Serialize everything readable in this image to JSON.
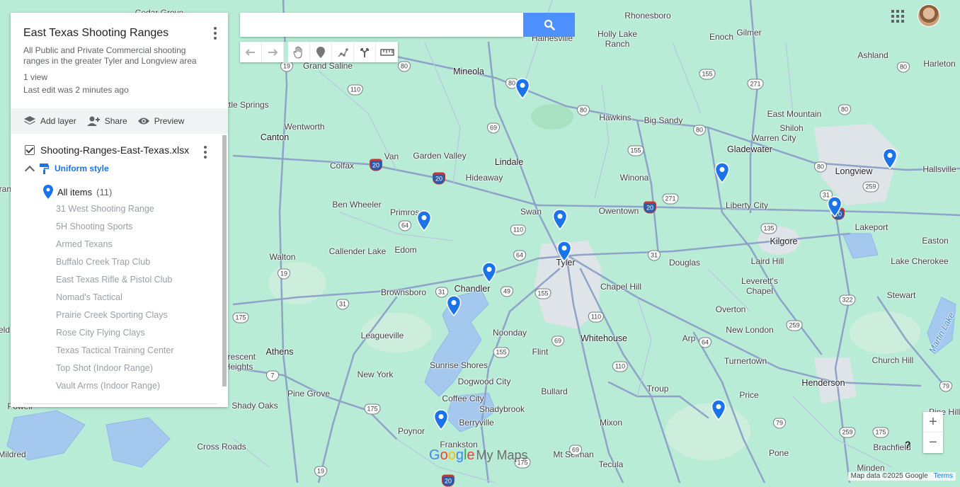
{
  "panel": {
    "title": "East Texas Shooting Ranges",
    "description": "All Public and Private Commercial shooting ranges in the greater Tyler and Longview area",
    "views": "1 view",
    "last_edit": "Last edit was 2 minutes ago",
    "toolbar": {
      "add_layer": "Add layer",
      "share": "Share",
      "preview": "Preview"
    },
    "layer": {
      "name": "Shooting-Ranges-East-Texas.xlsx",
      "checked": true,
      "style": "Uniform style",
      "all_items_label": "All items",
      "all_items_count": "(11)",
      "items": [
        "31 West Shooting Range",
        "5H Shooting Sports",
        "Armed Texans",
        "Buffalo Creek Trap Club",
        "East Texas Rifle & Pistol Club",
        "Nomad's Tactical",
        "Prairie Creek Sporting Clays",
        "Rose City Flying Clays",
        "Texas Tactical Training Center",
        "Top Shot (Indoor Range)",
        "Vault Arms (Indoor Range)"
      ]
    }
  },
  "search": {
    "value": "",
    "placeholder": ""
  },
  "tool_icons": [
    "undo-icon",
    "redo-icon",
    "hand-icon",
    "marker-icon",
    "draw-line-icon",
    "directions-icon",
    "ruler-icon"
  ],
  "map": {
    "places": [
      {
        "name": "Grand Saline"
      },
      {
        "name": "Rhonesboro"
      },
      {
        "name": "Gilmer"
      },
      {
        "name": "Enoch"
      },
      {
        "name": "Holly Lake Ranch"
      },
      {
        "name": "Hainesville"
      },
      {
        "name": "Ashland"
      },
      {
        "name": "Harleton"
      },
      {
        "name": "Mineola"
      },
      {
        "name": "Little Springs"
      },
      {
        "name": "Hawkins"
      },
      {
        "name": "Big Sandy"
      },
      {
        "name": "East Mountain"
      },
      {
        "name": "Shiloh"
      },
      {
        "name": "Warren City"
      },
      {
        "name": "Canton"
      },
      {
        "name": "Wentworth"
      },
      {
        "name": "Gladewater"
      },
      {
        "name": "Longview"
      },
      {
        "name": "Hallsville"
      },
      {
        "name": "Van"
      },
      {
        "name": "Garden Valley"
      },
      {
        "name": "Colfax"
      },
      {
        "name": "Lindale"
      },
      {
        "name": "Winona"
      },
      {
        "name": "Hideaway"
      },
      {
        "name": "Ben Wheeler"
      },
      {
        "name": "Primrose"
      },
      {
        "name": "Swan"
      },
      {
        "name": "Owentown"
      },
      {
        "name": "Liberty City"
      },
      {
        "name": "Lakeport"
      },
      {
        "name": "Easton"
      },
      {
        "name": "Callender Lake"
      },
      {
        "name": "Edom"
      },
      {
        "name": "Kilgore"
      },
      {
        "name": "Walton"
      },
      {
        "name": "Tyler"
      },
      {
        "name": "Douglas"
      },
      {
        "name": "Laird Hill"
      },
      {
        "name": "Lake Cherokee"
      },
      {
        "name": "Brownsboro"
      },
      {
        "name": "Chandler"
      },
      {
        "name": "Chapel Hill"
      },
      {
        "name": "Leverett's Chapel"
      },
      {
        "name": "Stewart"
      },
      {
        "name": "Overton"
      },
      {
        "name": "Leagueville"
      },
      {
        "name": "Noonday"
      },
      {
        "name": "Whitehouse"
      },
      {
        "name": "New London"
      },
      {
        "name": "Athens"
      },
      {
        "name": "Flint"
      },
      {
        "name": "Arp"
      },
      {
        "name": "Crescent Heights"
      },
      {
        "name": "Turnertown"
      },
      {
        "name": "Sunrise Shores"
      },
      {
        "name": "Church Hill"
      },
      {
        "name": "New York"
      },
      {
        "name": "Dogwood City"
      },
      {
        "name": "Bullard"
      },
      {
        "name": "Henderson"
      },
      {
        "name": "Pine Grove"
      },
      {
        "name": "Troup"
      },
      {
        "name": "Coffee City"
      },
      {
        "name": "Price"
      },
      {
        "name": "Shady Oaks"
      },
      {
        "name": "Shadybrook"
      },
      {
        "name": "Pine Hill"
      },
      {
        "name": "Berryville"
      },
      {
        "name": "Mixon"
      },
      {
        "name": "Poynor"
      },
      {
        "name": "Cross Roads"
      },
      {
        "name": "Mt Selman"
      },
      {
        "name": "Frankston"
      },
      {
        "name": "Pone"
      },
      {
        "name": "Brachfield"
      },
      {
        "name": "Mildred"
      },
      {
        "name": "Tecula"
      },
      {
        "name": "Minden"
      },
      {
        "name": "Cedar Grove"
      },
      {
        "name": "Powell"
      },
      {
        "name": "Grand"
      },
      {
        "name": "eld"
      }
    ],
    "water_labels": [
      "Martin Lake"
    ],
    "highway_shields": [
      {
        "num": "19"
      },
      {
        "num": "80"
      },
      {
        "num": "80"
      },
      {
        "num": "155"
      },
      {
        "num": "80"
      },
      {
        "num": "110"
      },
      {
        "num": "271"
      },
      {
        "num": "80"
      },
      {
        "num": "80"
      },
      {
        "num": "69"
      },
      {
        "num": "80"
      },
      {
        "num": "155"
      },
      {
        "num": "20",
        "interstate": true
      },
      {
        "num": "20",
        "interstate": true
      },
      {
        "num": "80"
      },
      {
        "num": "259"
      },
      {
        "num": "271"
      },
      {
        "num": "20",
        "interstate": true
      },
      {
        "num": "20",
        "interstate": true
      },
      {
        "num": "31"
      },
      {
        "num": "64"
      },
      {
        "num": "110"
      },
      {
        "num": "135"
      },
      {
        "num": "64"
      },
      {
        "num": "31"
      },
      {
        "num": "19"
      },
      {
        "num": "31"
      },
      {
        "num": "49"
      },
      {
        "num": "155"
      },
      {
        "num": "31"
      },
      {
        "num": "175"
      },
      {
        "num": "110"
      },
      {
        "num": "322"
      },
      {
        "num": "259"
      },
      {
        "num": "69"
      },
      {
        "num": "155"
      },
      {
        "num": "110"
      },
      {
        "num": "64"
      },
      {
        "num": "7"
      },
      {
        "num": "175"
      },
      {
        "num": "79"
      },
      {
        "num": "79"
      },
      {
        "num": "175"
      },
      {
        "num": "69"
      },
      {
        "num": "259"
      },
      {
        "num": "19"
      },
      {
        "num": "175"
      },
      {
        "num": "20",
        "interstate": true
      }
    ],
    "markers": 11
  },
  "branding": {
    "logo_word": "Google",
    "logo_suffix": "My Maps"
  },
  "zoom": {
    "in": "+",
    "out": "−"
  },
  "help": "?",
  "attribution": {
    "data": "Map data ©2025 Google",
    "terms": "Terms"
  },
  "colors": {
    "map_bg": "#b8ecd6",
    "road": "#8fa3c9",
    "water": "#a5c8ef",
    "marker": "#1a73e8",
    "urban": "#dfe4e8"
  }
}
